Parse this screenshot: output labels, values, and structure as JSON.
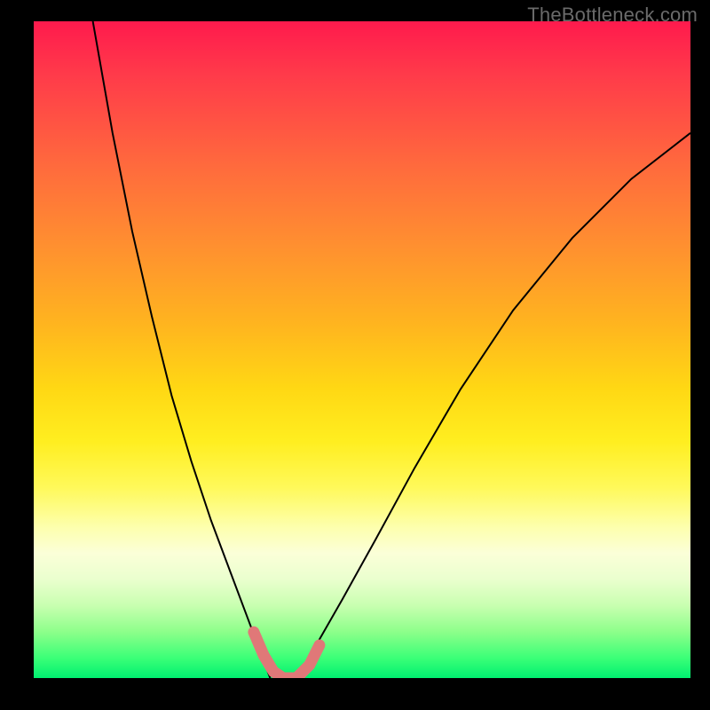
{
  "watermark": "TheBottleneck.com",
  "colors": {
    "frame": "#000000",
    "curve": "#000000",
    "marker": "#e07878",
    "gradient_stops": [
      "#ff1a4d",
      "#ff6a3d",
      "#ffb41f",
      "#ffee20",
      "#fdffad",
      "#c8ffb0",
      "#00f070"
    ]
  },
  "chart_data": {
    "type": "line",
    "title": "",
    "xlabel": "",
    "ylabel": "",
    "xlim": [
      0,
      100
    ],
    "ylim": [
      0,
      100
    ],
    "grid": false,
    "legend": false,
    "series": [
      {
        "name": "left-curve",
        "x": [
          9,
          12,
          15,
          18,
          21,
          24,
          27,
          30,
          33,
          34.5,
          36
        ],
        "values": [
          100,
          83,
          68,
          55,
          43,
          33,
          24,
          16,
          8,
          4,
          0
        ]
      },
      {
        "name": "right-curve",
        "x": [
          40,
          43,
          47,
          52,
          58,
          65,
          73,
          82,
          91,
          100
        ],
        "values": [
          0,
          5,
          12,
          21,
          32,
          44,
          56,
          67,
          76,
          83
        ]
      },
      {
        "name": "highlight-segment",
        "x": [
          33.5,
          35,
          36.5,
          38,
          40,
          42,
          43.5
        ],
        "values": [
          7,
          3.5,
          1,
          0,
          0,
          2,
          5
        ]
      }
    ],
    "annotations": [
      {
        "text": "TheBottleneck.com",
        "position": "top-right"
      }
    ]
  }
}
